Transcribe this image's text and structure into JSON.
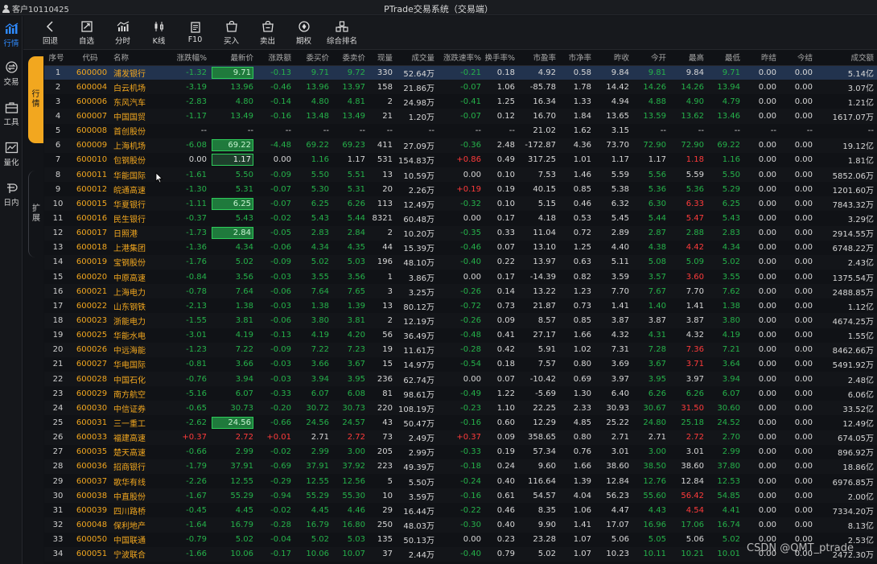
{
  "titlebar": {
    "account": "客户10110425",
    "title": "PTrade交易系统（交易端）"
  },
  "rail": [
    {
      "label": "行情",
      "icon": "chart-icon",
      "active": true
    },
    {
      "label": "交易",
      "icon": "exchange-icon",
      "active": false
    },
    {
      "label": "工具",
      "icon": "toolbox-icon",
      "active": false
    },
    {
      "label": "量化",
      "icon": "quant-icon",
      "active": false
    },
    {
      "label": "日内",
      "icon": "intraday-icon",
      "active": false
    }
  ],
  "toolbar": [
    {
      "label": "回退",
      "icon": "back-icon"
    },
    {
      "label": "自选",
      "icon": "watchlist-icon"
    },
    {
      "label": "分时",
      "icon": "timeshare-icon"
    },
    {
      "label": "K线",
      "icon": "candlestick-icon"
    },
    {
      "label": "F10",
      "icon": "f10-icon"
    },
    {
      "label": "买入",
      "icon": "buy-icon"
    },
    {
      "label": "卖出",
      "icon": "sell-icon"
    },
    {
      "label": "期权",
      "icon": "option-icon"
    },
    {
      "label": "综合排名",
      "icon": "ranking-icon"
    }
  ],
  "side_tabs": {
    "quotes": "行情",
    "expand": "扩展"
  },
  "columns": [
    "序号",
    "代码",
    "名称",
    "涨跌幅%",
    "最新价",
    "涨跌额",
    "委买价",
    "委卖价",
    "现量",
    "成交量",
    "涨跌速率%",
    "换手率%",
    "市盈率",
    "市净率",
    "昨收",
    "今开",
    "最高",
    "最低",
    "昨结",
    "今结",
    "成交额"
  ],
  "rows": [
    [
      "1",
      "600000",
      "浦发银行",
      "-1.32",
      "9.71",
      "-0.13",
      "9.71",
      "9.72",
      "330",
      "52.64万",
      "-0.21",
      "0.18",
      "4.92",
      "0.58",
      "9.84",
      "9.81",
      "9.84",
      "9.71",
      "0.00",
      "0.00",
      "5.14亿"
    ],
    [
      "2",
      "600004",
      "白云机场",
      "-3.19",
      "13.96",
      "-0.46",
      "13.96",
      "13.97",
      "158",
      "21.86万",
      "-0.07",
      "1.06",
      "-85.78",
      "1.78",
      "14.42",
      "14.26",
      "14.26",
      "13.94",
      "0.00",
      "0.00",
      "3.07亿"
    ],
    [
      "3",
      "600006",
      "东风汽车",
      "-2.83",
      "4.80",
      "-0.14",
      "4.80",
      "4.81",
      "2",
      "24.98万",
      "-0.41",
      "1.25",
      "16.34",
      "1.33",
      "4.94",
      "4.88",
      "4.90",
      "4.79",
      "0.00",
      "0.00",
      "1.21亿"
    ],
    [
      "4",
      "600007",
      "中国国贸",
      "-1.17",
      "13.49",
      "-0.16",
      "13.48",
      "13.49",
      "21",
      "1.20万",
      "-0.07",
      "0.12",
      "16.70",
      "1.84",
      "13.65",
      "13.59",
      "13.62",
      "13.46",
      "0.00",
      "0.00",
      "1617.07万"
    ],
    [
      "5",
      "600008",
      "首创股份",
      "--",
      "--",
      "--",
      "--",
      "--",
      "--",
      "--",
      "--",
      "--",
      "21.02",
      "1.62",
      "3.15",
      "--",
      "--",
      "--",
      "--",
      "--",
      "--"
    ],
    [
      "6",
      "600009",
      "上海机场",
      "-6.08",
      "69.22",
      "-4.48",
      "69.22",
      "69.23",
      "411",
      "27.09万",
      "-0.36",
      "2.48",
      "-172.87",
      "4.36",
      "73.70",
      "72.90",
      "72.90",
      "69.22",
      "0.00",
      "0.00",
      "19.12亿"
    ],
    [
      "7",
      "600010",
      "包钢股份",
      "0.00",
      "1.17",
      "0.00",
      "1.16",
      "1.17",
      "531",
      "154.83万",
      "+0.86",
      "0.49",
      "317.25",
      "1.01",
      "1.17",
      "1.17",
      "1.18",
      "1.16",
      "0.00",
      "0.00",
      "1.81亿"
    ],
    [
      "8",
      "600011",
      "华能国际",
      "-1.61",
      "5.50",
      "-0.09",
      "5.50",
      "5.51",
      "13",
      "10.59万",
      "0.00",
      "0.10",
      "7.53",
      "1.46",
      "5.59",
      "5.56",
      "5.59",
      "5.50",
      "0.00",
      "0.00",
      "5852.06万"
    ],
    [
      "9",
      "600012",
      "皖通高速",
      "-1.30",
      "5.31",
      "-0.07",
      "5.30",
      "5.31",
      "20",
      "2.26万",
      "+0.19",
      "0.19",
      "40.15",
      "0.85",
      "5.38",
      "5.36",
      "5.36",
      "5.29",
      "0.00",
      "0.00",
      "1201.60万"
    ],
    [
      "10",
      "600015",
      "华夏银行",
      "-1.11",
      "6.25",
      "-0.07",
      "6.25",
      "6.26",
      "113",
      "12.49万",
      "-0.32",
      "0.10",
      "5.15",
      "0.46",
      "6.32",
      "6.30",
      "6.33",
      "6.25",
      "0.00",
      "0.00",
      "7843.32万"
    ],
    [
      "11",
      "600016",
      "民生银行",
      "-0.37",
      "5.43",
      "-0.02",
      "5.43",
      "5.44",
      "8321",
      "60.48万",
      "0.00",
      "0.17",
      "4.18",
      "0.53",
      "5.45",
      "5.44",
      "5.47",
      "5.43",
      "0.00",
      "0.00",
      "3.29亿"
    ],
    [
      "12",
      "600017",
      "日照港",
      "-1.73",
      "2.84",
      "-0.05",
      "2.83",
      "2.84",
      "2",
      "10.20万",
      "-0.35",
      "0.33",
      "11.04",
      "0.72",
      "2.89",
      "2.87",
      "2.88",
      "2.83",
      "0.00",
      "0.00",
      "2914.55万"
    ],
    [
      "13",
      "600018",
      "上港集团",
      "-1.36",
      "4.34",
      "-0.06",
      "4.34",
      "4.35",
      "44",
      "15.39万",
      "-0.46",
      "0.07",
      "13.10",
      "1.25",
      "4.40",
      "4.38",
      "4.42",
      "4.34",
      "0.00",
      "0.00",
      "6748.22万"
    ],
    [
      "14",
      "600019",
      "宝钢股份",
      "-1.76",
      "5.02",
      "-0.09",
      "5.02",
      "5.03",
      "196",
      "48.10万",
      "-0.40",
      "0.22",
      "13.97",
      "0.63",
      "5.11",
      "5.08",
      "5.09",
      "5.02",
      "0.00",
      "0.00",
      "2.43亿"
    ],
    [
      "15",
      "600020",
      "中原高速",
      "-0.84",
      "3.56",
      "-0.03",
      "3.55",
      "3.56",
      "1",
      "3.86万",
      "0.00",
      "0.17",
      "-14.39",
      "0.82",
      "3.59",
      "3.57",
      "3.60",
      "3.55",
      "0.00",
      "0.00",
      "1375.54万"
    ],
    [
      "16",
      "600021",
      "上海电力",
      "-0.78",
      "7.64",
      "-0.06",
      "7.64",
      "7.65",
      "3",
      "3.25万",
      "-0.26",
      "0.14",
      "13.22",
      "1.23",
      "7.70",
      "7.67",
      "7.70",
      "7.62",
      "0.00",
      "0.00",
      "2488.85万"
    ],
    [
      "17",
      "600022",
      "山东钢铁",
      "-2.13",
      "1.38",
      "-0.03",
      "1.38",
      "1.39",
      "13",
      "80.12万",
      "-0.72",
      "0.73",
      "21.87",
      "0.73",
      "1.41",
      "1.40",
      "1.41",
      "1.38",
      "0.00",
      "0.00",
      "1.12亿"
    ],
    [
      "18",
      "600023",
      "浙能电力",
      "-1.55",
      "3.81",
      "-0.06",
      "3.80",
      "3.81",
      "2",
      "12.19万",
      "-0.26",
      "0.09",
      "8.57",
      "0.85",
      "3.87",
      "3.87",
      "3.87",
      "3.80",
      "0.00",
      "0.00",
      "4674.25万"
    ],
    [
      "19",
      "600025",
      "华能水电",
      "-3.01",
      "4.19",
      "-0.13",
      "4.19",
      "4.20",
      "56",
      "36.49万",
      "-0.48",
      "0.41",
      "27.17",
      "1.66",
      "4.32",
      "4.31",
      "4.32",
      "4.19",
      "0.00",
      "0.00",
      "1.55亿"
    ],
    [
      "20",
      "600026",
      "中远海能",
      "-1.23",
      "7.22",
      "-0.09",
      "7.22",
      "7.23",
      "19",
      "11.61万",
      "-0.28",
      "0.42",
      "5.91",
      "1.02",
      "7.31",
      "7.28",
      "7.36",
      "7.21",
      "0.00",
      "0.00",
      "8462.66万"
    ],
    [
      "21",
      "600027",
      "华电国际",
      "-0.81",
      "3.66",
      "-0.03",
      "3.66",
      "3.67",
      "15",
      "14.97万",
      "-0.54",
      "0.18",
      "7.57",
      "0.80",
      "3.69",
      "3.67",
      "3.71",
      "3.64",
      "0.00",
      "0.00",
      "5491.92万"
    ],
    [
      "22",
      "600028",
      "中国石化",
      "-0.76",
      "3.94",
      "-0.03",
      "3.94",
      "3.95",
      "236",
      "62.74万",
      "0.00",
      "0.07",
      "-10.42",
      "0.69",
      "3.97",
      "3.95",
      "3.97",
      "3.94",
      "0.00",
      "0.00",
      "2.48亿"
    ],
    [
      "23",
      "600029",
      "南方航空",
      "-5.16",
      "6.07",
      "-0.33",
      "6.07",
      "6.08",
      "81",
      "98.61万",
      "-0.49",
      "1.22",
      "-5.69",
      "1.30",
      "6.40",
      "6.26",
      "6.26",
      "6.07",
      "0.00",
      "0.00",
      "6.06亿"
    ],
    [
      "24",
      "600030",
      "中信证券",
      "-0.65",
      "30.73",
      "-0.20",
      "30.72",
      "30.73",
      "220",
      "108.19万",
      "-0.23",
      "1.10",
      "22.25",
      "2.33",
      "30.93",
      "30.67",
      "31.50",
      "30.60",
      "0.00",
      "0.00",
      "33.52亿"
    ],
    [
      "25",
      "600031",
      "三一重工",
      "-2.62",
      "24.56",
      "-0.66",
      "24.56",
      "24.57",
      "43",
      "50.47万",
      "-0.16",
      "0.60",
      "12.29",
      "4.85",
      "25.22",
      "24.80",
      "25.18",
      "24.52",
      "0.00",
      "0.00",
      "12.49亿"
    ],
    [
      "26",
      "600033",
      "福建高速",
      "+0.37",
      "2.72",
      "+0.01",
      "2.71",
      "2.72",
      "73",
      "2.49万",
      "+0.37",
      "0.09",
      "358.65",
      "0.80",
      "2.71",
      "2.71",
      "2.72",
      "2.70",
      "0.00",
      "0.00",
      "674.05万"
    ],
    [
      "27",
      "600035",
      "楚天高速",
      "-0.66",
      "2.99",
      "-0.02",
      "2.99",
      "3.00",
      "205",
      "2.99万",
      "-0.33",
      "0.19",
      "57.34",
      "0.76",
      "3.01",
      "3.00",
      "3.01",
      "2.99",
      "0.00",
      "0.00",
      "896.92万"
    ],
    [
      "28",
      "600036",
      "招商银行",
      "-1.79",
      "37.91",
      "-0.69",
      "37.91",
      "37.92",
      "223",
      "49.39万",
      "-0.18",
      "0.24",
      "9.60",
      "1.66",
      "38.60",
      "38.50",
      "38.60",
      "37.80",
      "0.00",
      "0.00",
      "18.86亿"
    ],
    [
      "29",
      "600037",
      "歌华有线",
      "-2.26",
      "12.55",
      "-0.29",
      "12.55",
      "12.56",
      "5",
      "5.50万",
      "-0.24",
      "0.40",
      "116.64",
      "1.39",
      "12.84",
      "12.76",
      "12.84",
      "12.53",
      "0.00",
      "0.00",
      "6976.85万"
    ],
    [
      "30",
      "600038",
      "中直股份",
      "-1.67",
      "55.29",
      "-0.94",
      "55.29",
      "55.30",
      "10",
      "3.59万",
      "-0.16",
      "0.61",
      "54.57",
      "4.04",
      "56.23",
      "55.60",
      "56.42",
      "54.85",
      "0.00",
      "0.00",
      "2.00亿"
    ],
    [
      "31",
      "600039",
      "四川路桥",
      "-0.45",
      "4.45",
      "-0.02",
      "4.45",
      "4.46",
      "29",
      "16.44万",
      "-0.22",
      "0.46",
      "8.35",
      "1.06",
      "4.47",
      "4.43",
      "4.54",
      "4.41",
      "0.00",
      "0.00",
      "7334.20万"
    ],
    [
      "32",
      "600048",
      "保利地产",
      "-1.64",
      "16.79",
      "-0.28",
      "16.79",
      "16.80",
      "250",
      "48.03万",
      "-0.30",
      "0.40",
      "9.90",
      "1.41",
      "17.07",
      "16.96",
      "17.06",
      "16.74",
      "0.00",
      "0.00",
      "8.13亿"
    ],
    [
      "33",
      "600050",
      "中国联通",
      "-0.79",
      "5.02",
      "-0.04",
      "5.02",
      "5.03",
      "135",
      "50.13万",
      "0.00",
      "0.23",
      "23.28",
      "1.07",
      "5.06",
      "5.05",
      "5.06",
      "5.02",
      "0.00",
      "0.00",
      "2.53亿"
    ],
    [
      "34",
      "600051",
      "宁波联合",
      "-1.66",
      "10.06",
      "-0.17",
      "10.06",
      "10.07",
      "37",
      "2.44万",
      "-0.40",
      "0.79",
      "5.02",
      "1.07",
      "10.23",
      "10.11",
      "10.21",
      "10.01",
      "0.00",
      "0.00",
      "2472.30万"
    ]
  ],
  "highlighted_prices": [
    "1",
    "6",
    "7",
    "10",
    "12",
    "25"
  ],
  "watermark": "CSDN @QMT_ptrade"
}
